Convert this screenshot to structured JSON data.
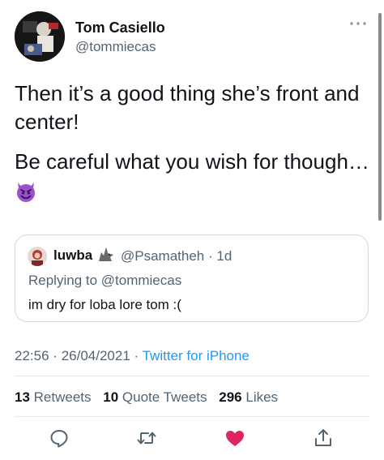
{
  "author": {
    "name": "Tom Casiello",
    "handle": "@tommiecas"
  },
  "tweet": {
    "line1": "Then it’s a good thing she’s front and center!",
    "line2": "Be careful what you wish for though…",
    "emoji": "smiling-devil-emoji"
  },
  "quote": {
    "name": "luwba",
    "name_icon": "wolf-emoji",
    "handle": "@Psamatheh",
    "separator": "·",
    "time": "1d",
    "replying_to": "Replying to @tommiecas",
    "text": "im dry for loba lore tom :("
  },
  "meta": {
    "time": "22:56",
    "separator": "·",
    "date": "26/04/2021",
    "source": "Twitter for iPhone"
  },
  "stats": {
    "retweets_count": "13",
    "retweets_label": "Retweets",
    "quotes_count": "10",
    "quotes_label": "Quote Tweets",
    "likes_count": "296",
    "likes_label": "Likes"
  },
  "actions": {
    "reply_icon": "reply-icon",
    "retweet_icon": "retweet-icon",
    "like_icon": "heart-icon",
    "share_icon": "share-icon"
  },
  "colors": {
    "like_active": "#f91880",
    "link": "#1d9bf0",
    "secondary_text": "#536471",
    "primary_text": "#0f1419"
  }
}
